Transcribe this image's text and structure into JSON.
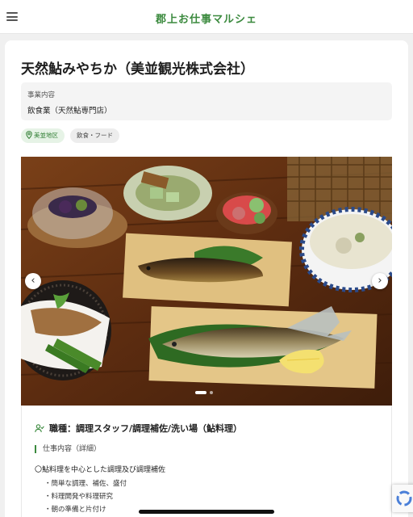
{
  "header": {
    "site_title": "郡上お仕事マルシェ",
    "menu_icon": "hamburger-menu-icon"
  },
  "shop": {
    "name": "天然鮎みやちか（美並観光株式会社）",
    "business_label": "事業内容",
    "business_value": "飲食業（天然鮎専門店）",
    "tags": {
      "area": "美並地区",
      "category": "飲食・フード"
    }
  },
  "gallery": {
    "image_description_icon": "food-photo",
    "prev_label": "‹",
    "next_label": "›",
    "current_slide": 1,
    "total_slides": 2
  },
  "job": {
    "title": "職種：調理スタッフ/調理補佐/洗い場（鮎料理）",
    "detail_label": "仕事内容（詳細）",
    "description_head": "〇鮎料理を中心とした調理及び調理補佐",
    "tasks": [
      "簡単な調理、補佐、盛付",
      "料理開発や料理研究",
      "朝の準備と片付け"
    ]
  },
  "colors": {
    "brand_green": "#3b8a3e",
    "tag_green_bg": "#e6f3e6"
  }
}
